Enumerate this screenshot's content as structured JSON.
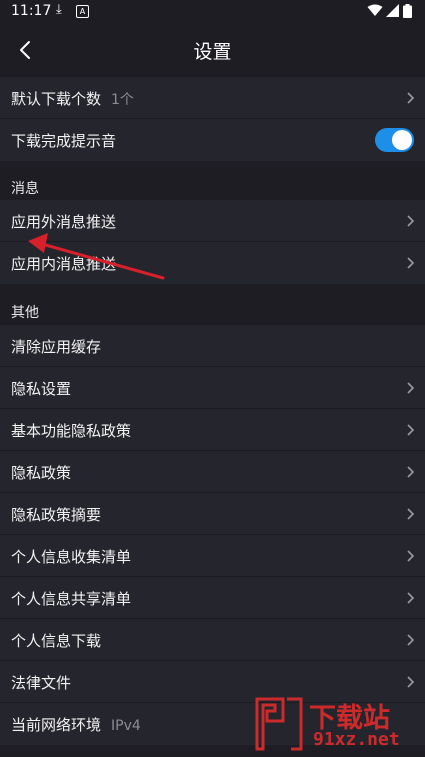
{
  "status_bar": {
    "time": "11:17",
    "download_glyph": "⤓",
    "a_glyph": "A"
  },
  "header": {
    "title": "设置"
  },
  "download_section": {
    "rows": [
      {
        "label": "默认下载个数",
        "value": "1个"
      },
      {
        "label": "下载完成提示音",
        "toggle_on": true
      }
    ]
  },
  "messages_group": {
    "title": "消息",
    "rows": [
      {
        "label": "应用外消息推送"
      },
      {
        "label": "应用内消息推送"
      }
    ]
  },
  "other_group": {
    "title": "其他",
    "rows": [
      {
        "label": "清除应用缓存"
      },
      {
        "label": "隐私设置"
      },
      {
        "label": "基本功能隐私政策"
      },
      {
        "label": "隐私政策"
      },
      {
        "label": "隐私政策摘要"
      },
      {
        "label": "个人信息收集清单"
      },
      {
        "label": "个人信息共享清单"
      },
      {
        "label": "个人信息下载"
      },
      {
        "label": "法律文件"
      },
      {
        "label": "当前网络环境",
        "value": "IPv4"
      }
    ]
  },
  "watermark": {
    "line1": "下载站",
    "line2": "91xz.net"
  },
  "colors": {
    "accent": "#1e8fe8",
    "background": "#1e1d24",
    "row_background": "#25252d",
    "annotation_arrow": "#d8202a"
  }
}
